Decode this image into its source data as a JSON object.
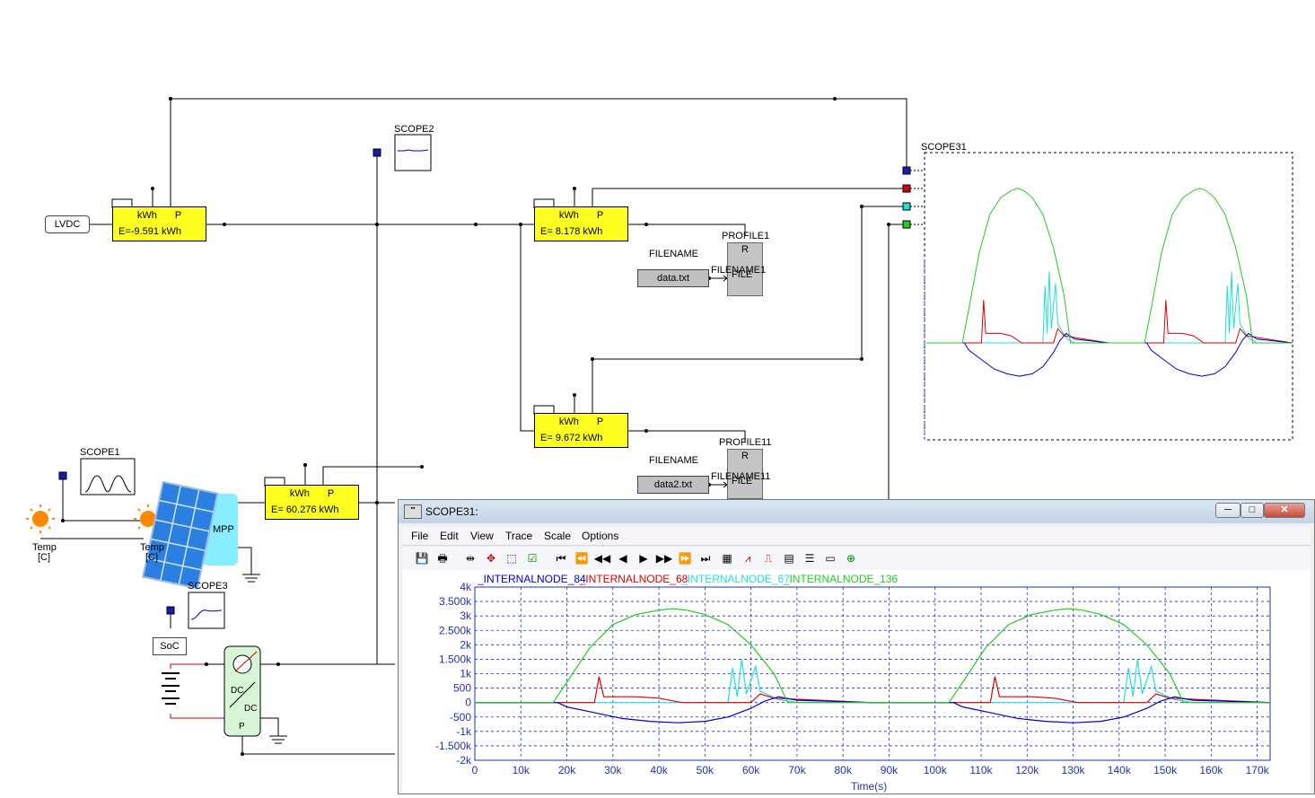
{
  "schematic": {
    "lvdc_label": "LVDC",
    "scope2": "SCOPE2",
    "scope1": "SCOPE1",
    "scope3": "SCOPE3",
    "scope31": "SCOPE31",
    "meter_header_left": "kWh",
    "meter_header_right": "P",
    "meters": [
      {
        "value": "E=-9.591 kWh"
      },
      {
        "value": "E= 8.178 kWh"
      },
      {
        "value": "E= 9.672 kWh"
      },
      {
        "value": "E= 60.276 kWh"
      }
    ],
    "filename_label": "FILENAME",
    "file1": "data.txt",
    "file2": "data2.txt",
    "profile1": "PROFILE1",
    "profile11": "PROFILE11",
    "profile_r": "R",
    "profile_file": "FILE",
    "filename1_label": "FILENAME1",
    "filename11_label": "FILENAME11",
    "temp_label": "Temp",
    "temp_unit": "[C]",
    "mpp_label": "MPP",
    "soc_label": "SoC",
    "dcdc_top": "DC",
    "dcdc_bot": "DC",
    "dcdc_p": "P"
  },
  "window": {
    "title": "SCOPE31:",
    "menu": [
      "File",
      "Edit",
      "View",
      "Trace",
      "Scale",
      "Options"
    ],
    "controls": {
      "minimize": "─",
      "maximize": "□",
      "close": "✕"
    }
  },
  "colors": {
    "blue": "#0000cc",
    "red": "#dd0000",
    "cyan": "#22dddd",
    "green": "#22cc22",
    "grid": "#2233aa"
  },
  "chart_data": {
    "type": "line",
    "series": [
      {
        "name": "_INTERNALNODE_84",
        "color": "#0000cc"
      },
      {
        "name": "_INTERNALNODE_68",
        "color": "#dd0000"
      },
      {
        "name": "_INTERNALNODE_67",
        "color": "#22dddd"
      },
      {
        "name": "_INTERNALNODE_136",
        "color": "#22cc22"
      }
    ],
    "xlabel": "Time(s)",
    "xlim": [
      0,
      172800
    ],
    "ylim": [
      -2000,
      4000
    ],
    "x_ticks": [
      "0",
      "10k",
      "20k",
      "30k",
      "40k",
      "50k",
      "60k",
      "70k",
      "80k",
      "90k",
      "100k",
      "110k",
      "120k",
      "130k",
      "140k",
      "150k",
      "160k",
      "170k"
    ],
    "y_ticks": [
      "4k",
      "3.500k",
      "3k",
      "2.500k",
      "2k",
      "1.500k",
      "1k",
      "500",
      "0",
      "-500",
      "-1k",
      "-1.500k",
      "-2k"
    ],
    "green_series_points": [
      [
        0,
        0
      ],
      [
        17000,
        0
      ],
      [
        20000,
        700
      ],
      [
        25000,
        1900
      ],
      [
        30000,
        2700
      ],
      [
        35000,
        3050
      ],
      [
        40000,
        3200
      ],
      [
        43000,
        3250
      ],
      [
        46000,
        3200
      ],
      [
        50000,
        3050
      ],
      [
        55000,
        2700
      ],
      [
        60000,
        2000
      ],
      [
        65000,
        1000
      ],
      [
        68000,
        0
      ],
      [
        103000,
        0
      ],
      [
        106000,
        700
      ],
      [
        111000,
        1900
      ],
      [
        116000,
        2700
      ],
      [
        121000,
        3050
      ],
      [
        126000,
        3200
      ],
      [
        129000,
        3250
      ],
      [
        132000,
        3200
      ],
      [
        136000,
        3050
      ],
      [
        141000,
        2700
      ],
      [
        146000,
        2000
      ],
      [
        151000,
        1000
      ],
      [
        154000,
        0
      ],
      [
        172800,
        0
      ]
    ],
    "blue_series_points": [
      [
        0,
        0
      ],
      [
        18000,
        0
      ],
      [
        20000,
        -150
      ],
      [
        26000,
        -350
      ],
      [
        32000,
        -550
      ],
      [
        38000,
        -650
      ],
      [
        44000,
        -700
      ],
      [
        50000,
        -650
      ],
      [
        55000,
        -500
      ],
      [
        60000,
        -200
      ],
      [
        63000,
        50
      ],
      [
        66000,
        200
      ],
      [
        70000,
        80
      ],
      [
        86000,
        0
      ],
      [
        104000,
        0
      ],
      [
        106000,
        -150
      ],
      [
        112000,
        -350
      ],
      [
        118000,
        -550
      ],
      [
        124000,
        -650
      ],
      [
        130000,
        -700
      ],
      [
        136000,
        -650
      ],
      [
        141000,
        -500
      ],
      [
        146000,
        -200
      ],
      [
        149000,
        50
      ],
      [
        152000,
        200
      ],
      [
        156000,
        80
      ],
      [
        172800,
        0
      ]
    ],
    "red_series_points": [
      [
        0,
        0
      ],
      [
        26000,
        0
      ],
      [
        27000,
        900
      ],
      [
        28000,
        200
      ],
      [
        35000,
        200
      ],
      [
        40000,
        150
      ],
      [
        45000,
        0
      ],
      [
        60000,
        0
      ],
      [
        62000,
        300
      ],
      [
        65000,
        150
      ],
      [
        86000,
        0
      ],
      [
        112000,
        0
      ],
      [
        113000,
        900
      ],
      [
        114000,
        200
      ],
      [
        121000,
        200
      ],
      [
        126000,
        150
      ],
      [
        131000,
        0
      ],
      [
        146000,
        0
      ],
      [
        148000,
        300
      ],
      [
        151000,
        150
      ],
      [
        172800,
        0
      ]
    ],
    "cyan_series_points": [
      [
        0,
        0
      ],
      [
        55000,
        0
      ],
      [
        56000,
        1200
      ],
      [
        57000,
        200
      ],
      [
        58000,
        1500
      ],
      [
        59000,
        300
      ],
      [
        61000,
        1250
      ],
      [
        62000,
        400
      ],
      [
        66000,
        100
      ],
      [
        70000,
        0
      ],
      [
        141000,
        0
      ],
      [
        142000,
        1200
      ],
      [
        143000,
        200
      ],
      [
        144000,
        1500
      ],
      [
        145000,
        300
      ],
      [
        147000,
        1250
      ],
      [
        148000,
        400
      ],
      [
        152000,
        100
      ],
      [
        156000,
        0
      ],
      [
        172800,
        0
      ]
    ]
  }
}
